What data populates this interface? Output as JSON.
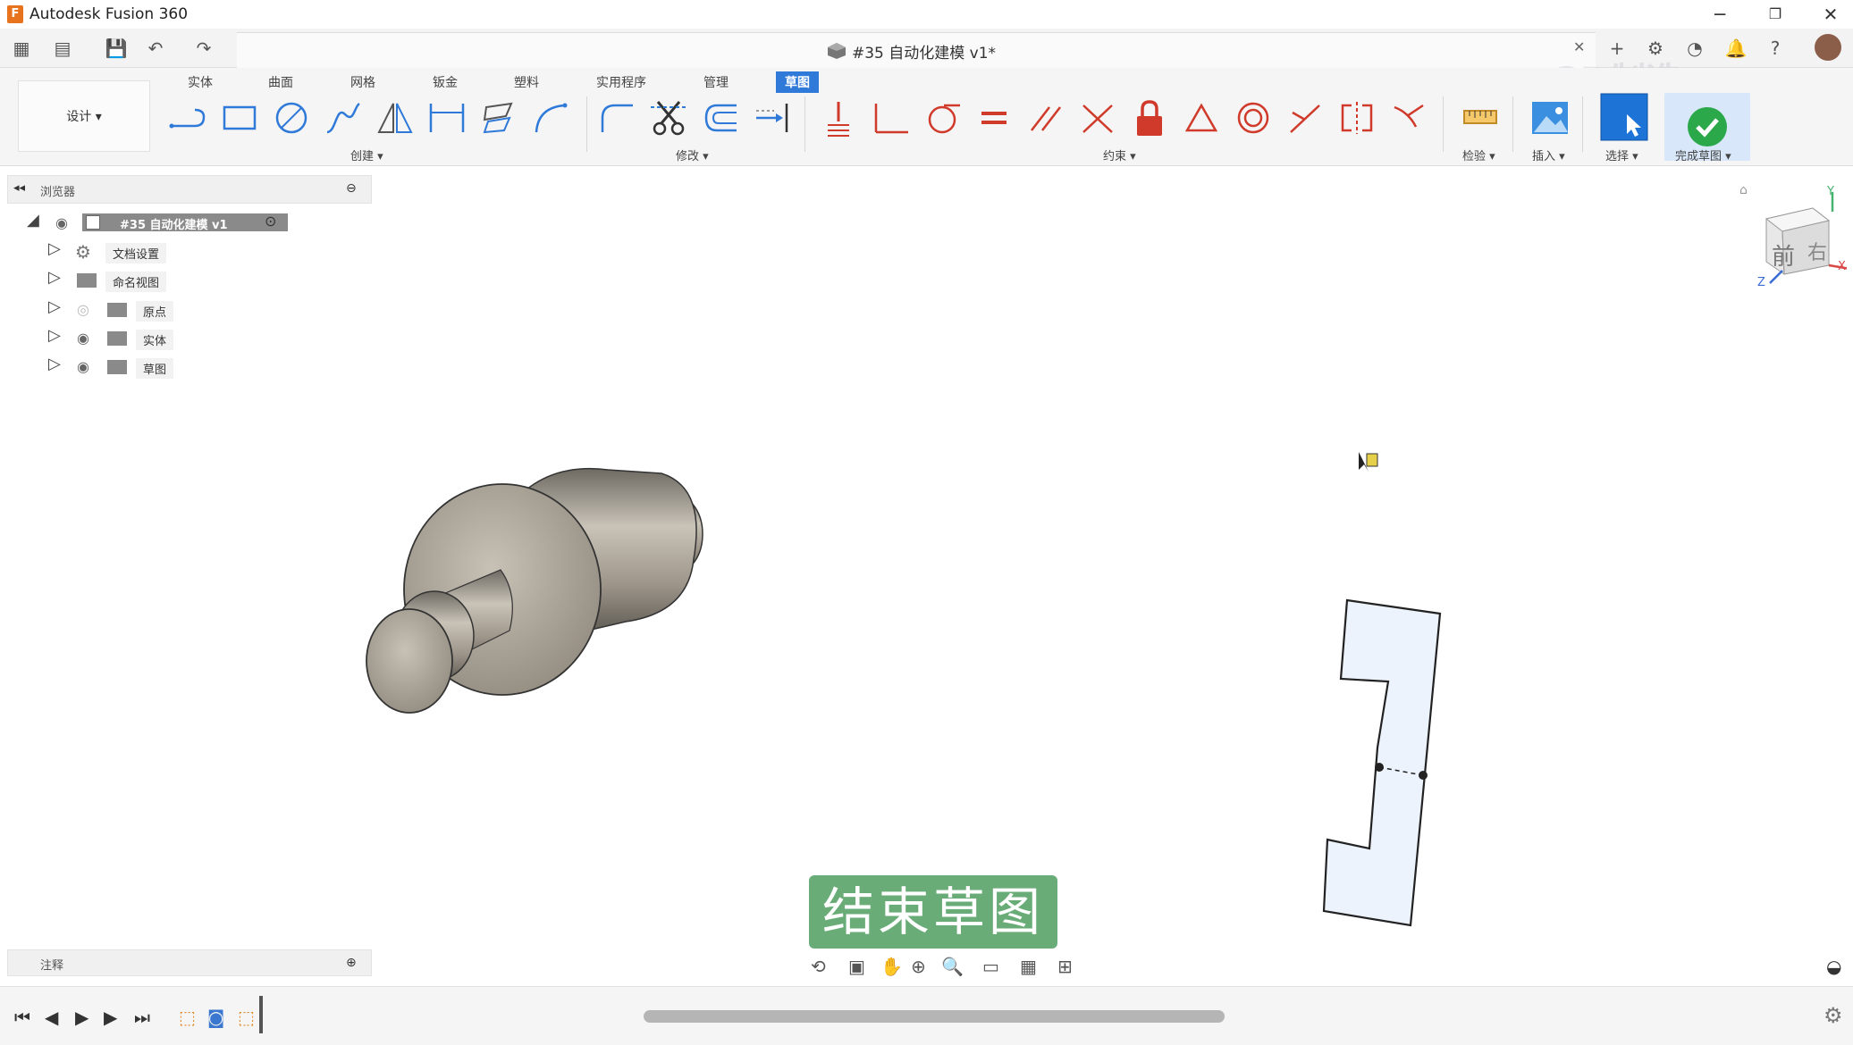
{
  "titlebar": {
    "app_title": "Autodesk Fusion 360",
    "logo_letter": "F",
    "minimize": "─",
    "restore": "❐",
    "close": "✕"
  },
  "docbar": {
    "doc_title": "#35  自动化建模 v1*",
    "close_tab": "✕",
    "watermark": "3D制造"
  },
  "ribbon": {
    "design_button": "设计 ▾",
    "tabs": [
      "实体",
      "曲面",
      "网格",
      "钣金",
      "塑料",
      "实用程序",
      "管理",
      "草图"
    ],
    "active_tab": "草图",
    "groups": {
      "create": "创建 ▾",
      "modify": "修改 ▾",
      "constraints": "约束 ▾",
      "inspect": "检验 ▾",
      "insert": "插入 ▾",
      "select": "选择 ▾",
      "finish": "完成草图 ▾"
    }
  },
  "browser": {
    "title": "浏览器",
    "root": "#35  自动化建模 v1",
    "items": [
      {
        "label": "文档设置",
        "icon": "gear-icon"
      },
      {
        "label": "命名视图",
        "icon": "folder-icon"
      },
      {
        "label": "原点",
        "icon": "folder-icon"
      },
      {
        "label": "实体",
        "icon": "folder-icon"
      },
      {
        "label": "草图",
        "icon": "folder-icon"
      }
    ]
  },
  "annotation": {
    "title": "注释"
  },
  "viewcube": {
    "face_front": "前",
    "face_right": "右",
    "axis_x": "X",
    "axis_y": "Y",
    "axis_z": "Z"
  },
  "tooltip": {
    "finish_sketch": "结束草图"
  },
  "colors": {
    "accent": "#2f79d9",
    "finish_green": "#6aac78",
    "part_metal": "#9d958a",
    "sketch_fill": "#edf3fc"
  }
}
